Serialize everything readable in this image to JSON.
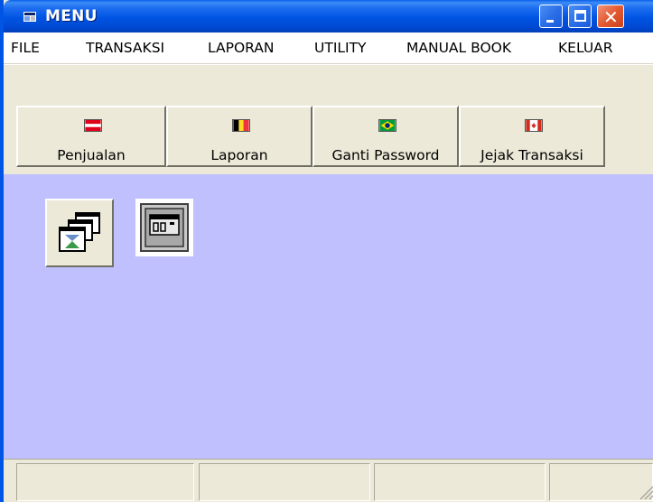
{
  "window": {
    "title": "MENU",
    "title_color": "#ffffff",
    "titlebar_color": "#0054e3"
  },
  "titlebar_buttons": {
    "minimize": "minimize-icon",
    "maximize": "maximize-icon",
    "close": "close-icon",
    "close_glyph": "✕"
  },
  "menubar": {
    "items": [
      "FILE",
      "TRANSAKSI",
      "LAPORAN",
      "UTILITY",
      "MANUAL BOOK",
      "KELUAR"
    ]
  },
  "toolbar": {
    "buttons": [
      {
        "label": "Penjualan",
        "icon": "austria-flag-icon"
      },
      {
        "label": "Laporan",
        "icon": "belgium-flag-icon"
      },
      {
        "label": "Ganti Password",
        "icon": "brazil-flag-icon"
      },
      {
        "label": "Jejak Transaksi",
        "icon": "canada-flag-icon"
      }
    ]
  },
  "content": {
    "background": "#c0c0ff",
    "icons": [
      "window-stack-icon",
      "calculator-icon"
    ]
  },
  "statusbar": {
    "panels": [
      "",
      "",
      "",
      ""
    ]
  }
}
